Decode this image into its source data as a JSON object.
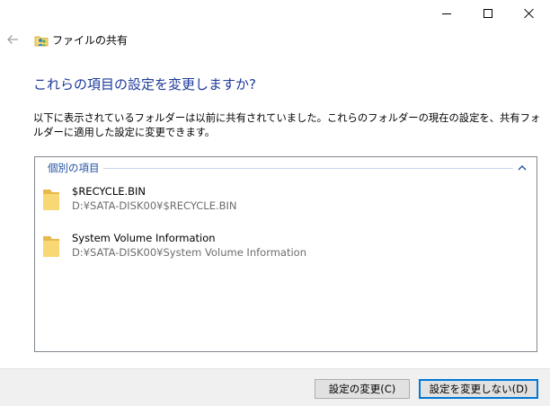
{
  "window": {
    "title": "ファイルの共有"
  },
  "icons": {
    "minimize": "minimize-icon",
    "maximize": "maximize-icon",
    "close": "close-icon",
    "back": "back-arrow-icon",
    "app": "file-sharing-icon",
    "folder": "folder-icon",
    "collapse": "chevron-up-icon"
  },
  "colors": {
    "heading": "#1c3a9a",
    "group_label": "#1f4fa0",
    "primary_button_border": "#0078d7",
    "footer_background": "#f0f0f0",
    "folder": "#f8d775"
  },
  "main": {
    "heading": "これらの項目の設定を変更しますか?",
    "description": "以下に表示されているフォルダーは以前に共有されていました。これらのフォルダーの現在の設定を、共有フォルダーに適用した設定に変更できます。"
  },
  "list": {
    "group_label": "個別の項目",
    "items": [
      {
        "name": "$RECYCLE.BIN",
        "path": "D:¥SATA-DISK00¥$RECYCLE.BIN"
      },
      {
        "name": "System Volume Information",
        "path": "D:¥SATA-DISK00¥System Volume Information"
      }
    ]
  },
  "footer": {
    "change_label": "設定の変更(C)",
    "no_change_label": "設定を変更しない(D)"
  }
}
